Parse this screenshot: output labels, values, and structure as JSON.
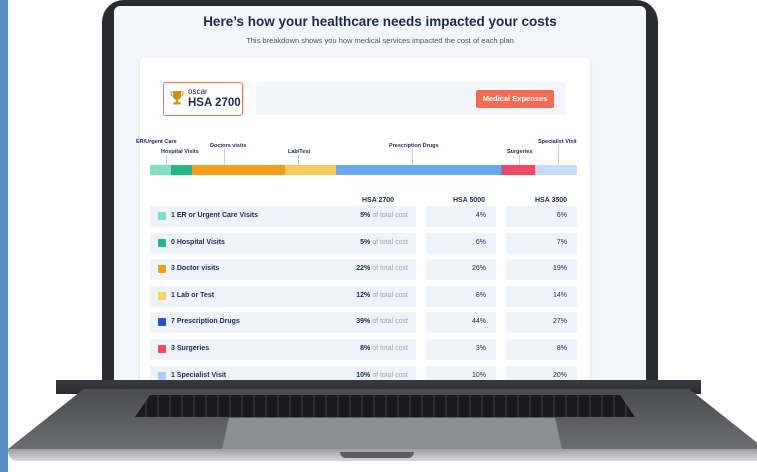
{
  "header": {
    "title": "Here’s how your healthcare needs impacted your costs",
    "subtitle": "This breakdown shows you how medical services impacted the cost of each plan"
  },
  "plan": {
    "brand": "oscar",
    "name": "HSA 2700",
    "icon": "trophy-icon"
  },
  "toggle": {
    "label": "Medical Expenses"
  },
  "bar_labels": {
    "er": "ER/Urgent Care",
    "hospital": "Hospital Visits",
    "doctors": "Doctors visits",
    "lab": "Lab/Test",
    "rx": "Prescription Drugs",
    "surgeries": "Surgeries",
    "specialist": "Specialist Visit"
  },
  "breakdown": {
    "shares_percent": [
      5,
      5,
      22,
      12,
      39,
      8,
      10
    ],
    "colors": [
      "#7fe3c0",
      "#1fb985",
      "#f29e1a",
      "#fbc95c",
      "#6aa9f0",
      "#ee4a63",
      "#c6dcf7"
    ]
  },
  "table": {
    "columns": [
      "HSA 2700",
      "HSA 5000",
      "HSA 3500"
    ],
    "suffix": "of total cost",
    "rows": [
      {
        "label": "1 ER or Urgent Care Visits",
        "pct": "5%",
        "v2": "4%",
        "v3": "6%",
        "color": "#7fe3c0"
      },
      {
        "label": "0 Hospital Visits",
        "pct": "5%",
        "v2": "6%",
        "v3": "7%",
        "color": "#1fb985"
      },
      {
        "label": "3 Doctor visits",
        "pct": "22%",
        "v2": "26%",
        "v3": "19%",
        "color": "#f29e1a"
      },
      {
        "label": "1 Lab or Test",
        "pct": "12%",
        "v2": "8%",
        "v3": "14%",
        "color": "#fbd25e"
      },
      {
        "label": "7 Prescription Drugs",
        "pct": "39%",
        "v2": "44%",
        "v3": "27%",
        "color": "#2b4fd6"
      },
      {
        "label": "3 Surgeries",
        "pct": "8%",
        "v2": "3%",
        "v3": "8%",
        "color": "#ee4a63"
      },
      {
        "label": "1 Specialist Visit",
        "pct": "10%",
        "v2": "10%",
        "v3": "20%",
        "color": "#a9cdf5"
      }
    ]
  }
}
